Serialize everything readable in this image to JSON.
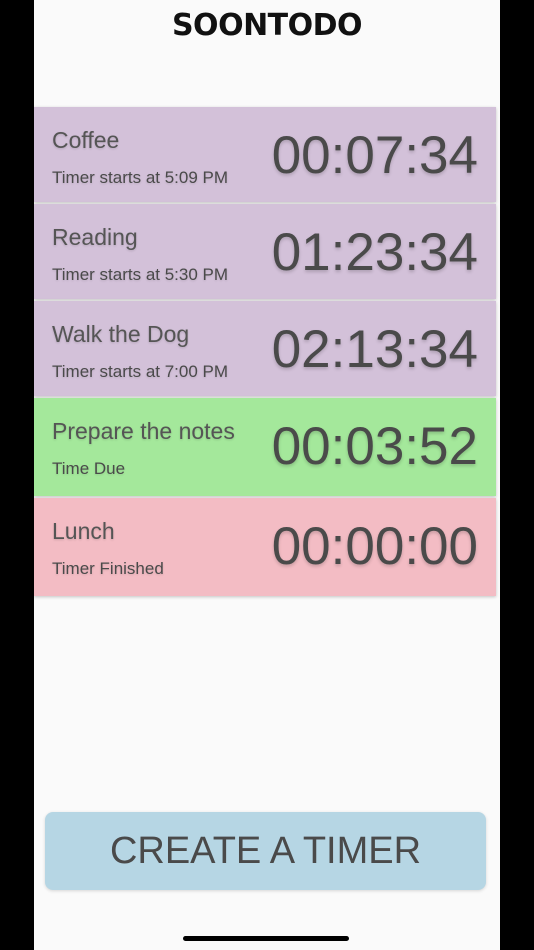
{
  "app": {
    "title": "SOONTODO"
  },
  "colors": {
    "upcoming": "#d3c1d9",
    "due": "#a4e89b",
    "finished": "#f3bcc4",
    "button": "#b6d6e4"
  },
  "timers": [
    {
      "name": "Coffee",
      "status": "Timer starts at 5:09 PM",
      "countdown": "00:07:34",
      "state": "upcoming"
    },
    {
      "name": "Reading",
      "status": "Timer starts at 5:30 PM",
      "countdown": "01:23:34",
      "state": "upcoming"
    },
    {
      "name": "Walk the Dog",
      "status": "Timer starts at 7:00 PM",
      "countdown": "02:13:34",
      "state": "upcoming"
    },
    {
      "name": "Prepare the notes",
      "status": "Time Due",
      "countdown": "00:03:52",
      "state": "due"
    },
    {
      "name": "Lunch",
      "status": "Timer Finished",
      "countdown": "00:00:00",
      "state": "finished"
    }
  ],
  "create_button": {
    "label": "CREATE A TIMER"
  }
}
